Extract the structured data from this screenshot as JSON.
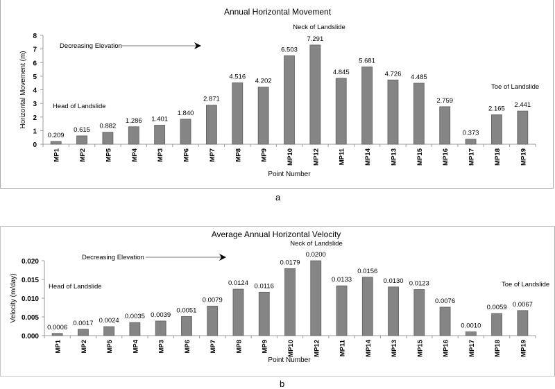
{
  "panel_labels": {
    "a": "a",
    "b": "b"
  },
  "chart_data": [
    {
      "type": "bar",
      "title": "Annual Horizontal Movement",
      "xlabel": "Point Number",
      "ylabel": "Horizontal Movement (m)",
      "ylim": [
        0,
        8
      ],
      "yticks": [
        0,
        1,
        2,
        3,
        4,
        5,
        6,
        7,
        8
      ],
      "ytick_labels": [
        "0",
        "1",
        "2",
        "3",
        "4",
        "5",
        "6",
        "7",
        "8"
      ],
      "grid": false,
      "categories": [
        "MP1",
        "MP2",
        "MP5",
        "MP4",
        "MP3",
        "MP6",
        "MP7",
        "MP8",
        "MP9",
        "MP10",
        "MP12",
        "MP11",
        "MP14",
        "MP13",
        "MP15",
        "MP16",
        "MP17",
        "MP18",
        "MP19"
      ],
      "values": [
        0.209,
        0.615,
        0.882,
        1.286,
        1.401,
        1.84,
        2.871,
        4.516,
        4.202,
        6.503,
        7.291,
        4.845,
        5.681,
        4.726,
        4.485,
        2.759,
        0.373,
        2.165,
        2.441
      ],
      "data_labels": [
        "0.209",
        "0.615",
        "0.882",
        "1.286",
        "1.401",
        "1.840",
        "2.871",
        "4.516",
        "4.202",
        "6.503",
        "7.291",
        "4.845",
        "5.681",
        "4.726",
        "4.485",
        "2.759",
        "0.373",
        "2.165",
        "2.441"
      ],
      "bar_color": "#858585",
      "annotations": {
        "arrow": "Decreasing Elevation",
        "head": "Head of Landslide",
        "neck": "Neck of Landslide",
        "toe": "Toe of Landslide"
      }
    },
    {
      "type": "bar",
      "title": "Average Annual Horizontal Velocity",
      "xlabel": "Point Number",
      "ylabel": "Velocity (m/day)",
      "ylim": [
        0,
        0.02
      ],
      "yticks": [
        0,
        0.005,
        0.01,
        0.015,
        0.02
      ],
      "ytick_labels": [
        "0.000",
        "0.005",
        "0.010",
        "0.015",
        "0.020"
      ],
      "grid": false,
      "categories": [
        "MP1",
        "MP2",
        "MP5",
        "MP4",
        "MP3",
        "MP6",
        "MP7",
        "MP8",
        "MP9",
        "MP10",
        "MP12",
        "MP11",
        "MP14",
        "MP13",
        "MP15",
        "MP16",
        "MP17",
        "MP18",
        "MP19"
      ],
      "values": [
        0.0006,
        0.0017,
        0.0024,
        0.0035,
        0.0039,
        0.0051,
        0.0079,
        0.0124,
        0.0116,
        0.0179,
        0.02,
        0.0133,
        0.0156,
        0.013,
        0.0123,
        0.0076,
        0.001,
        0.0059,
        0.0067
      ],
      "data_labels": [
        "0.0006",
        "0.0017",
        "0.0024",
        "0.0035",
        "0.0039",
        "0.0051",
        "0.0079",
        "0.0124",
        "0.0116",
        "0.0179",
        "0.0200",
        "0.0133",
        "0.0156",
        "0.0130",
        "0.0123",
        "0.0076",
        "0.0010",
        "0.0059",
        "0.0067"
      ],
      "bar_color": "#858585",
      "annotations": {
        "arrow": "Decreasing Elevation",
        "head": "Head of Landslide",
        "neck": "Neck of Landslide",
        "toe": "Toe of Landslide"
      }
    }
  ]
}
